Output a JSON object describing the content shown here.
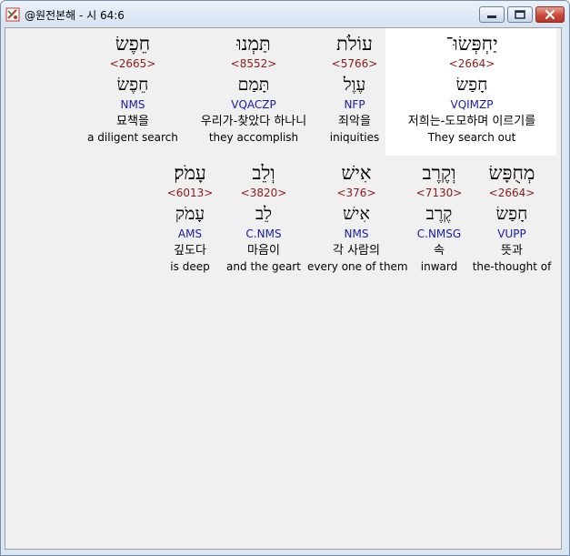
{
  "window": {
    "title": "@원전본해 - 시 64:6",
    "controls": {
      "minimize": "minimize-icon",
      "maximize": "maximize-icon",
      "close": "close-icon"
    }
  },
  "colors": {
    "strong": "#8b1a1a",
    "morph": "#1a1aaa",
    "highlight_bg": "#ffffff",
    "client_bg": "#f0f0f0"
  },
  "rows": [
    {
      "words": [
        {
          "heb": "חֵפֶשׂ",
          "strong": "<2665>",
          "lemma": "חֵפֶשׂ",
          "morph": "NMS",
          "kor": "묘책을",
          "eng": "a diligent search"
        },
        {
          "heb": "תַּמְנוּ",
          "strong": "<8552>",
          "lemma": "תָּמַם",
          "morph": "VQACZP",
          "kor": "우리가-찾았다 하나니",
          "eng": "they accomplish"
        },
        {
          "heb": "עוֹלֹת",
          "strong": "<5766>",
          "lemma": "עֶוֶל",
          "morph": "NFP",
          "kor": "죄악을",
          "eng": "iniquities"
        },
        {
          "heb": "יַחְפְּשׂוּ־",
          "strong": "<2664>",
          "lemma": "חָפַשׂ",
          "morph": "VQIMZP",
          "kor": "저희는-도모하며 이르기를",
          "eng": "They search out",
          "highlighted": true
        }
      ]
    },
    {
      "words": [
        {
          "heb": "עָמֹק׃",
          "strong": "<6013>",
          "lemma": "עָמֹק",
          "morph": "AMS",
          "kor": "깊도다",
          "eng": "is deep"
        },
        {
          "heb": "וְלֵב",
          "strong": "<3820>",
          "lemma": "לֵב",
          "morph": "C.NMS",
          "kor": "마음이",
          "eng": "and the geart"
        },
        {
          "heb": "אִישׁ",
          "strong": "<376>",
          "lemma": "אִישׁ",
          "morph": "NMS",
          "kor": "각 사람의",
          "eng": "every one of them"
        },
        {
          "heb": "וְקֶרֶב",
          "strong": "<7130>",
          "lemma": "קֶרֶב",
          "morph": "C.NMSG",
          "kor": "속",
          "eng": "inward"
        },
        {
          "heb": "מְחֻפָּשׂ",
          "strong": "<2664>",
          "lemma": "חָפַשׂ",
          "morph": "VUPP",
          "kor": "뜻과",
          "eng": "the-thought of"
        }
      ]
    }
  ]
}
